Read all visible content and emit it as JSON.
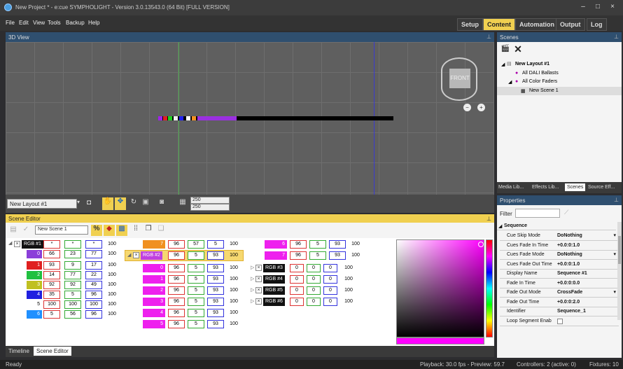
{
  "window": {
    "title": "New Project * - e:cue SYMPHOLIGHT - Version 3.0.13543.0 (64 Bit) [FULL VERSION]"
  },
  "menu": [
    "File",
    "Edit",
    "View",
    "Tools",
    "Backup",
    "Help"
  ],
  "modes": {
    "setup": "Setup",
    "content": "Content",
    "automation": "Automation",
    "output": "Output",
    "log": "Log"
  },
  "view3d": {
    "title": "3D View",
    "front": "FRONT"
  },
  "viewtoolbar": {
    "layout": "New Layout #1",
    "val1": "250",
    "val2": "250"
  },
  "sceneeditor": {
    "title": "Scene Editor",
    "scene_name": "New Scene 1",
    "rgb1": {
      "label": "RGB #1",
      "vals": [
        "*",
        "*",
        "*",
        "100"
      ],
      "rows": [
        [
          "0",
          "66",
          "23",
          "77",
          "100"
        ],
        [
          "1",
          "93",
          "9",
          "17",
          "100"
        ],
        [
          "2",
          "14",
          "77",
          "22",
          "100"
        ],
        [
          "3",
          "92",
          "92",
          "49",
          "100"
        ],
        [
          "4",
          "35",
          "5",
          "96",
          "100"
        ],
        [
          "5",
          "100",
          "100",
          "100",
          "100"
        ],
        [
          "6",
          "5",
          "56",
          "96",
          "100"
        ]
      ]
    },
    "col2": {
      "top": [
        "7",
        "96",
        "57",
        "5",
        "100"
      ],
      "rgb2": {
        "label": "RGB #2",
        "vals": [
          "96",
          "5",
          "93",
          "100"
        ]
      },
      "rows": [
        [
          "0",
          "96",
          "5",
          "93",
          "100"
        ],
        [
          "1",
          "96",
          "5",
          "93",
          "100"
        ],
        [
          "2",
          "96",
          "5",
          "93",
          "100"
        ],
        [
          "3",
          "96",
          "5",
          "93",
          "100"
        ],
        [
          "4",
          "96",
          "5",
          "93",
          "100"
        ],
        [
          "5",
          "96",
          "5",
          "93",
          "100"
        ]
      ]
    },
    "col3": {
      "rows": [
        [
          "6",
          "96",
          "5",
          "93",
          "100"
        ],
        [
          "7",
          "96",
          "5",
          "93",
          "100"
        ]
      ],
      "rgbs": [
        {
          "label": "RGB #3",
          "vals": [
            "0",
            "0",
            "0",
            "100"
          ]
        },
        {
          "label": "RGB #4",
          "vals": [
            "0",
            "0",
            "0",
            "100"
          ]
        },
        {
          "label": "RGB #5",
          "vals": [
            "0",
            "0",
            "0",
            "100"
          ]
        },
        {
          "label": "RGB #6",
          "vals": [
            "0",
            "0",
            "0",
            "100"
          ]
        }
      ]
    }
  },
  "bottomtabs": {
    "timeline": "Timeline",
    "sceneeditor": "Scene Editor"
  },
  "scenes": {
    "title": "Scenes",
    "tree": {
      "layout": "New Layout #1",
      "dali": "All DALI Ballasts",
      "color": "All Color Faders",
      "scene": "New Scene 1"
    },
    "tabs": [
      "Media Lib...",
      "Effects Lib...",
      "Scenes",
      "Source Eff..."
    ]
  },
  "properties": {
    "title": "Properties",
    "filter": "Filter",
    "section": "Sequence",
    "rows": [
      {
        "k": "Cue Skip Mode",
        "v": "DoNothing"
      },
      {
        "k": "Cues Fade In Time",
        "v": "+0.0:0:1.0"
      },
      {
        "k": "Cues Fade Mode",
        "v": "DoNothing"
      },
      {
        "k": "Cues Fade Out Time",
        "v": "+0.0:0:1.0"
      },
      {
        "k": "Display Name",
        "v": "Sequence #1"
      },
      {
        "k": "Fade In Time",
        "v": "+0.0:0:0.0"
      },
      {
        "k": "Fade Out Mode",
        "v": "CrossFade"
      },
      {
        "k": "Fade Out Time",
        "v": "+0.0:0:2.0"
      },
      {
        "k": "Identifier",
        "v": "Sequence_1"
      },
      {
        "k": "Loop Segment Enab",
        "v": ""
      }
    ]
  },
  "status": {
    "ready": "Ready",
    "playback": "Playback: 30.0 fps - Preview: 59.7",
    "controllers": "Controllers: 2 (active: 0)",
    "fixtures": "Fixtures: 10"
  },
  "colors": {
    "accent": "#f0d050",
    "header": "#2f4f6f",
    "picker_hue": "#ff00ff"
  }
}
